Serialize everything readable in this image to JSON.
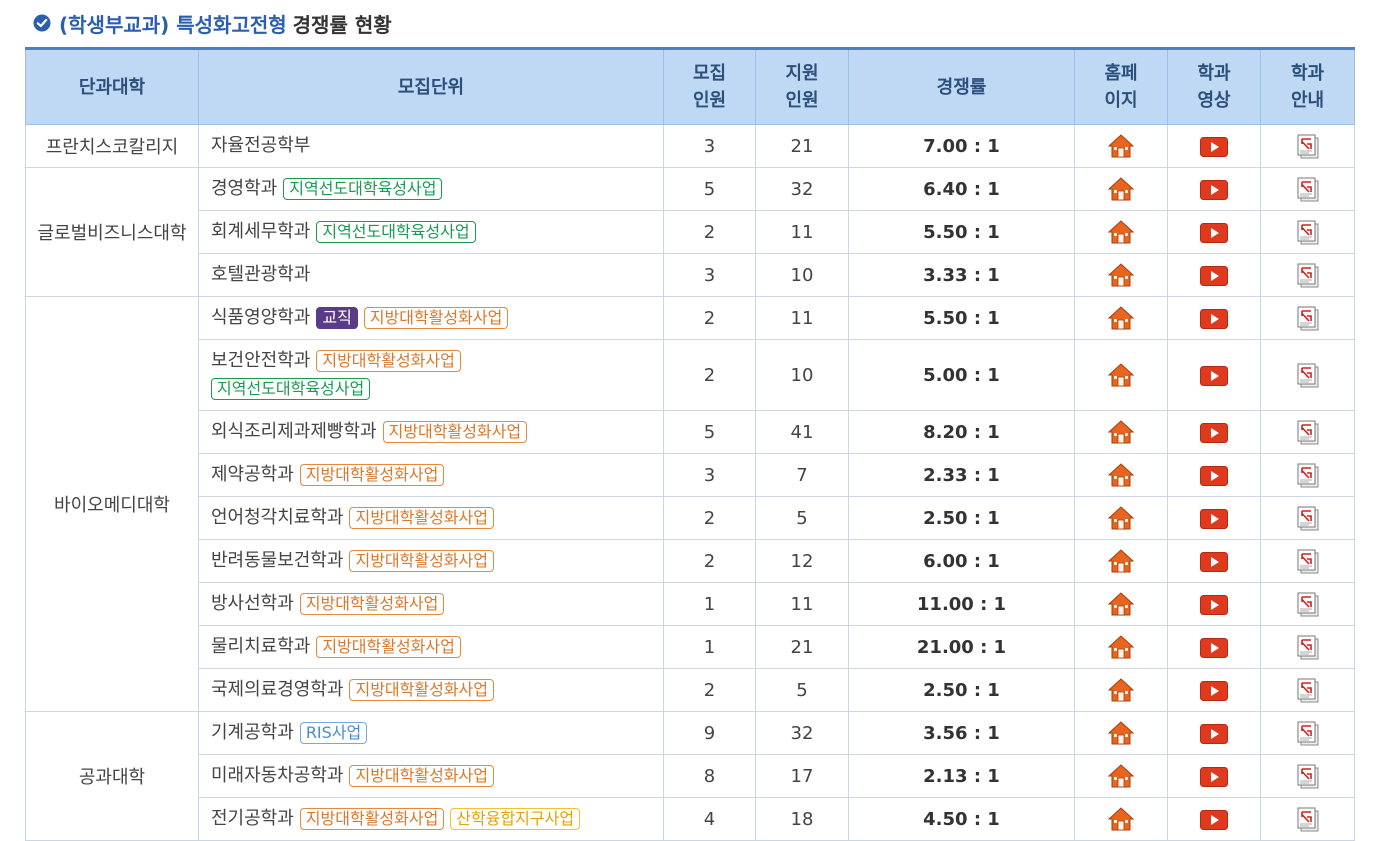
{
  "title": {
    "prefix": "(학생부교과) 특성화고전형",
    "suffix": "경쟁률 현황"
  },
  "headers": {
    "college": "단과대학",
    "unit": "모집단위",
    "quota_l1": "모집",
    "quota_l2": "인원",
    "applied_l1": "지원",
    "applied_l2": "인원",
    "ratio": "경쟁률",
    "home_l1": "홈페",
    "home_l2": "이지",
    "video_l1": "학과",
    "video_l2": "영상",
    "guide_l1": "학과",
    "guide_l2": "안내"
  },
  "colleges": {
    "c1": "프란치스코칼리지",
    "c2": "글로벌비즈니스대학",
    "c3": "바이오메디대학",
    "c4": "공과대학"
  },
  "rows": [
    {
      "unit": "자율전공학부",
      "quota": "3",
      "applied": "21",
      "ratio": "7.00 : 1"
    },
    {
      "unit": "경영학과",
      "tag1": "지역선도대학육성사업",
      "quota": "5",
      "applied": "32",
      "ratio": "6.40 : 1"
    },
    {
      "unit": "회계세무학과",
      "tag1": "지역선도대학육성사업",
      "quota": "2",
      "applied": "11",
      "ratio": "5.50 : 1"
    },
    {
      "unit": "호텔관광학과",
      "quota": "3",
      "applied": "10",
      "ratio": "3.33 : 1"
    },
    {
      "unit": "식품영양학과",
      "tag0": "교직",
      "tag1": "지방대학활성화사업",
      "quota": "2",
      "applied": "11",
      "ratio": "5.50 : 1"
    },
    {
      "unit": "보건안전학과",
      "tag1": "지방대학활성화사업",
      "tag2": "지역선도대학육성사업",
      "quota": "2",
      "applied": "10",
      "ratio": "5.00 : 1"
    },
    {
      "unit": "외식조리제과제빵학과",
      "tag1": "지방대학활성화사업",
      "quota": "5",
      "applied": "41",
      "ratio": "8.20 : 1"
    },
    {
      "unit": "제약공학과",
      "tag1": "지방대학활성화사업",
      "quota": "3",
      "applied": "7",
      "ratio": "2.33 : 1"
    },
    {
      "unit": "언어청각치료학과",
      "tag1": "지방대학활성화사업",
      "quota": "2",
      "applied": "5",
      "ratio": "2.50 : 1"
    },
    {
      "unit": "반려동물보건학과",
      "tag1": "지방대학활성화사업",
      "quota": "2",
      "applied": "12",
      "ratio": "6.00 : 1"
    },
    {
      "unit": "방사선학과",
      "tag1": "지방대학활성화사업",
      "quota": "1",
      "applied": "11",
      "ratio": "11.00 : 1"
    },
    {
      "unit": "물리치료학과",
      "tag1": "지방대학활성화사업",
      "quota": "1",
      "applied": "21",
      "ratio": "21.00 : 1"
    },
    {
      "unit": "국제의료경영학과",
      "tag1": "지방대학활성화사업",
      "quota": "2",
      "applied": "5",
      "ratio": "2.50 : 1"
    },
    {
      "unit": "기계공학과",
      "tag1": "RIS사업",
      "quota": "9",
      "applied": "32",
      "ratio": "3.56 : 1"
    },
    {
      "unit": "미래자동차공학과",
      "tag1": "지방대학활성화사업",
      "quota": "8",
      "applied": "17",
      "ratio": "2.13 : 1"
    },
    {
      "unit": "전기공학과",
      "tag1": "지방대학활성화사업",
      "tag2": "산학융합지구사업",
      "quota": "4",
      "applied": "18",
      "ratio": "4.50 : 1"
    }
  ],
  "icons": {
    "title": "check-circle-icon",
    "home": "home-icon",
    "video": "play-icon",
    "guide": "pdf-document-icon"
  },
  "colors": {
    "header_bg": "#bfd9f4",
    "header_text": "#2d4f7c",
    "accent_top": "#4f7ec2",
    "tag_green": "#1b9a52",
    "tag_orange": "#d9782b",
    "tag_blue": "#4a8bcf",
    "tag_yellow": "#e0a500",
    "tag_purple": "#5a3b87"
  }
}
